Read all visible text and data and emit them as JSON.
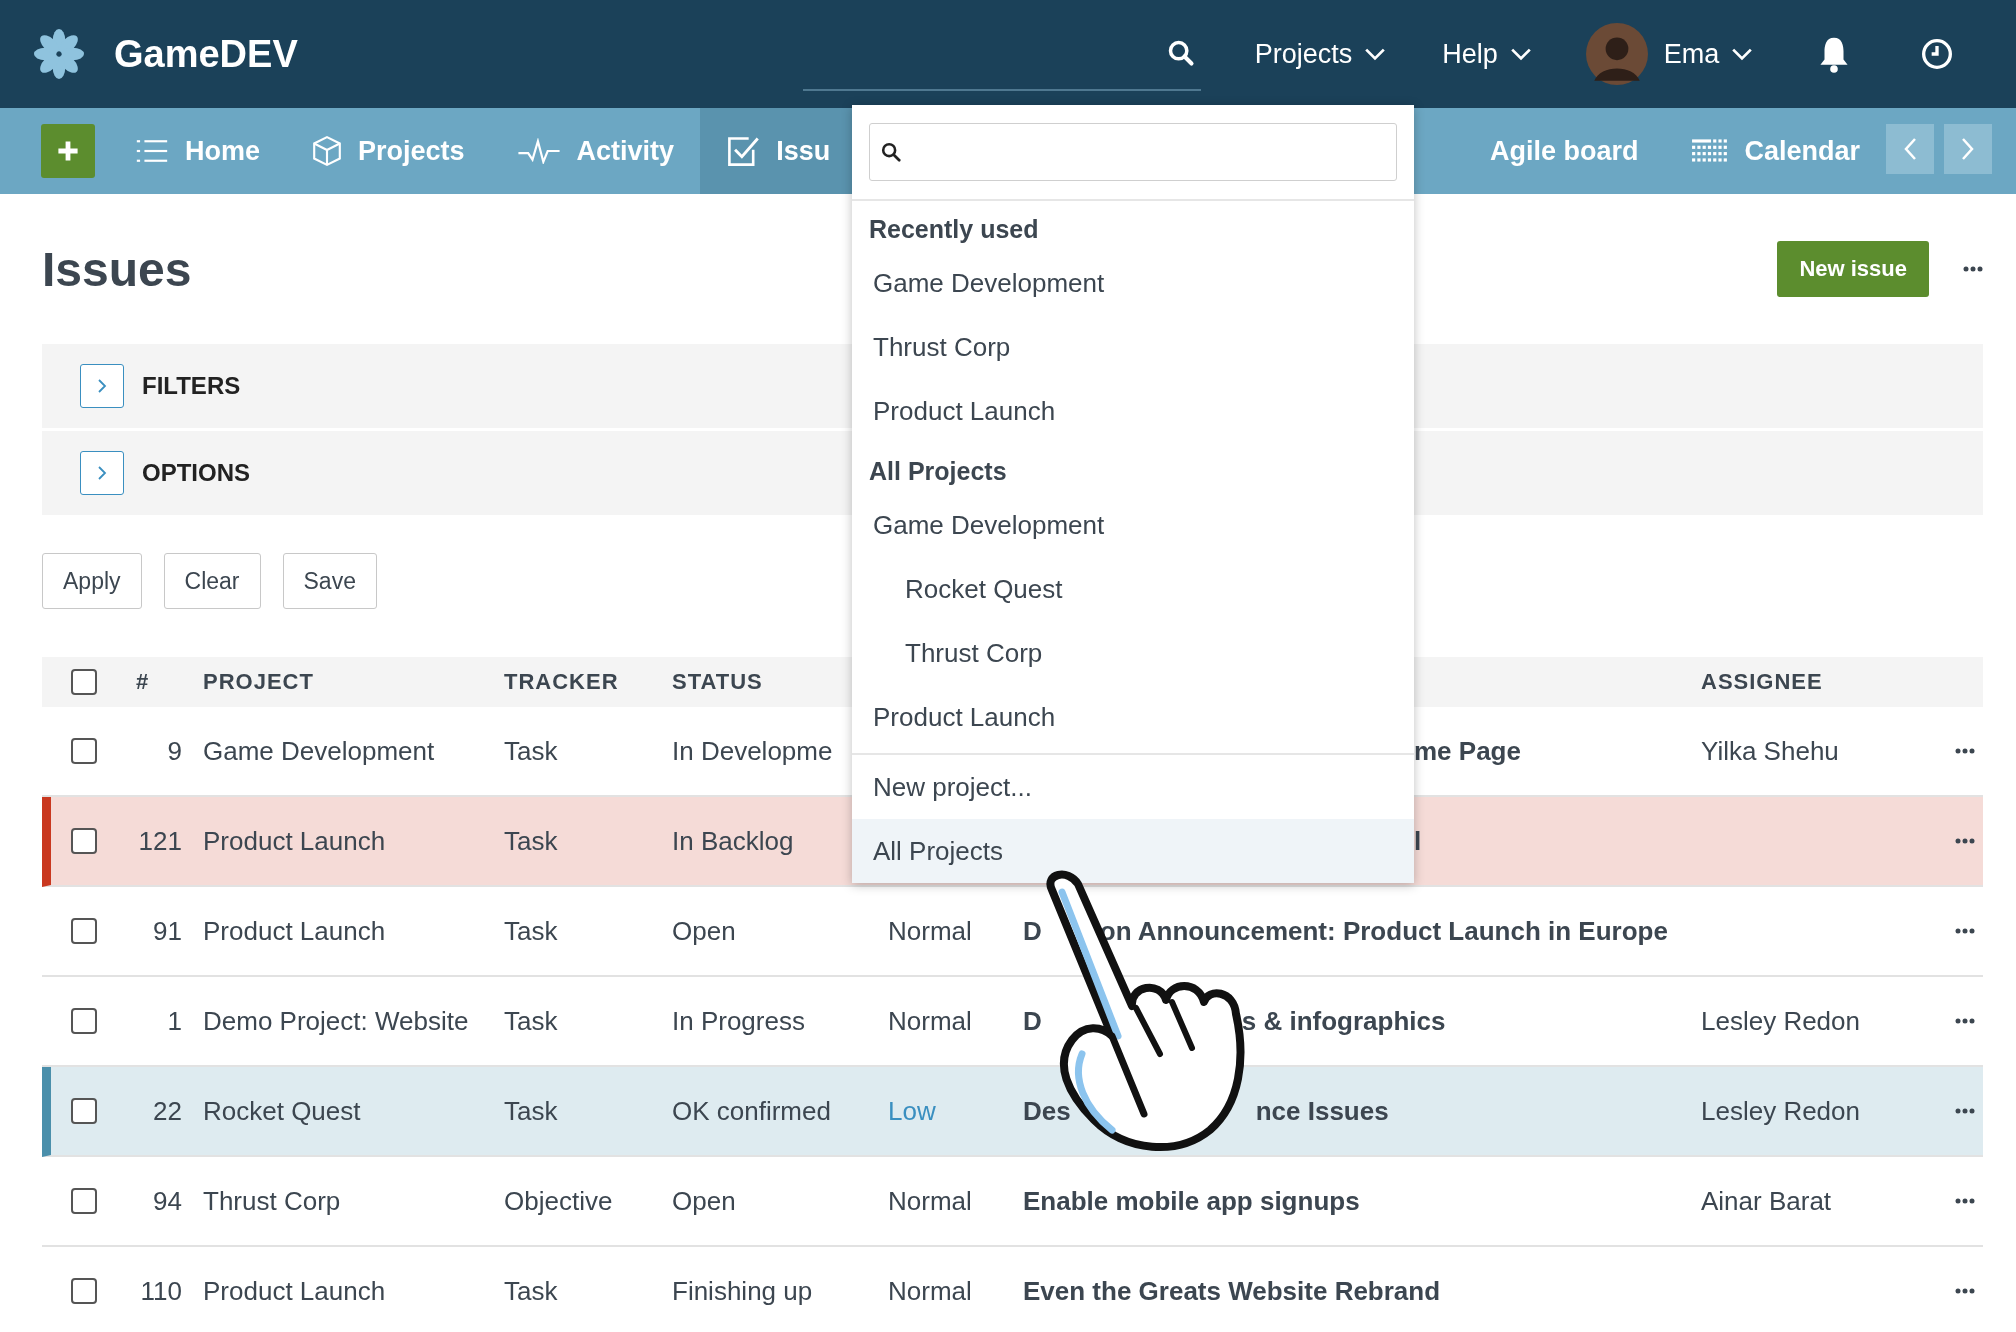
{
  "app": {
    "name": "GameDEV"
  },
  "topbar": {
    "menus": [
      {
        "label": "Projects"
      },
      {
        "label": "Help"
      }
    ],
    "user": {
      "name": "Ema"
    }
  },
  "nav": {
    "items": [
      {
        "label": "Home",
        "selected": false
      },
      {
        "label": "Projects",
        "selected": false
      },
      {
        "label": "Activity",
        "selected": false
      },
      {
        "label": "Issu",
        "selected": true
      },
      {
        "label": "Agile board",
        "selected": false
      },
      {
        "label": "Calendar",
        "selected": false
      }
    ]
  },
  "page": {
    "title": "Issues",
    "primary_button": "New issue"
  },
  "panels": [
    {
      "label": "FILTERS",
      "expanded": false
    },
    {
      "label": "OPTIONS",
      "expanded": false
    }
  ],
  "buttons": [
    "Apply",
    "Clear",
    "Save"
  ],
  "table": {
    "columns": [
      "#",
      "PROJECT",
      "TRACKER",
      "STATUS",
      "ASSIGNEE"
    ],
    "all_checked": false,
    "rows": [
      {
        "id": "9",
        "project": "Game Development",
        "tracker": "Task",
        "status": "In Developme",
        "subject": [
          "me Page"
        ],
        "assignee": "Yilka Shehu",
        "checked": false
      },
      {
        "id": "121",
        "project": "Product Launch",
        "tracker": "Task",
        "status": "In Backlog",
        "subject": [
          "l"
        ],
        "assignee": "",
        "checked": false,
        "color": "#c9381f"
      },
      {
        "id": "91",
        "project": "Product Launch",
        "tracker": "Task",
        "status": "Open",
        "priority": {
          "label": "Normal",
          "link": false
        },
        "subject": [
          "D",
          "on Announcement: Product Launch in Europe"
        ],
        "assignee": "",
        "checked": false
      },
      {
        "id": "1",
        "project": "Demo Project: Website",
        "tracker": "Task",
        "status": "In Progress",
        "priority": {
          "label": "Normal",
          "link": false
        },
        "subject": [
          "D",
          "s & infographics"
        ],
        "assignee": "Lesley Redon",
        "checked": false
      },
      {
        "id": "22",
        "project": "Rocket Quest",
        "tracker": "Task",
        "status": "OK confirmed",
        "priority": {
          "label": "Low",
          "link": true
        },
        "subject": [
          "Des",
          "nce Issues"
        ],
        "assignee": "Lesley Redon",
        "checked": false,
        "color": "#4a8fab"
      },
      {
        "id": "94",
        "project": "Thrust Corp",
        "tracker": "Objective",
        "status": "Open",
        "priority": {
          "label": "Normal",
          "link": false
        },
        "subject": [
          "Enable mobile app signups"
        ],
        "assignee": "Ainar Barat",
        "checked": false
      },
      {
        "id": "110",
        "project": "Product Launch",
        "tracker": "Task",
        "status": "Finishing up",
        "priority": {
          "label": "Normal",
          "link": false
        },
        "subject": [
          "Even the Greats Website Rebrand"
        ],
        "assignee": "",
        "checked": false
      }
    ]
  },
  "dropdown": {
    "sections": [
      {
        "heading": "Recently used",
        "items": [
          {
            "label": "Game Development"
          },
          {
            "label": "Thrust Corp"
          },
          {
            "label": "Product Launch"
          }
        ]
      },
      {
        "heading": "All Projects",
        "items": [
          {
            "label": "Game Development",
            "children": [
              {
                "label": "Rocket Quest"
              },
              {
                "label": "Thrust Corp"
              }
            ]
          },
          {
            "label": "Product Launch"
          }
        ]
      }
    ],
    "actions": [
      {
        "label": "New project...",
        "selected": false
      },
      {
        "label": "All Projects",
        "selected": true
      }
    ]
  }
}
